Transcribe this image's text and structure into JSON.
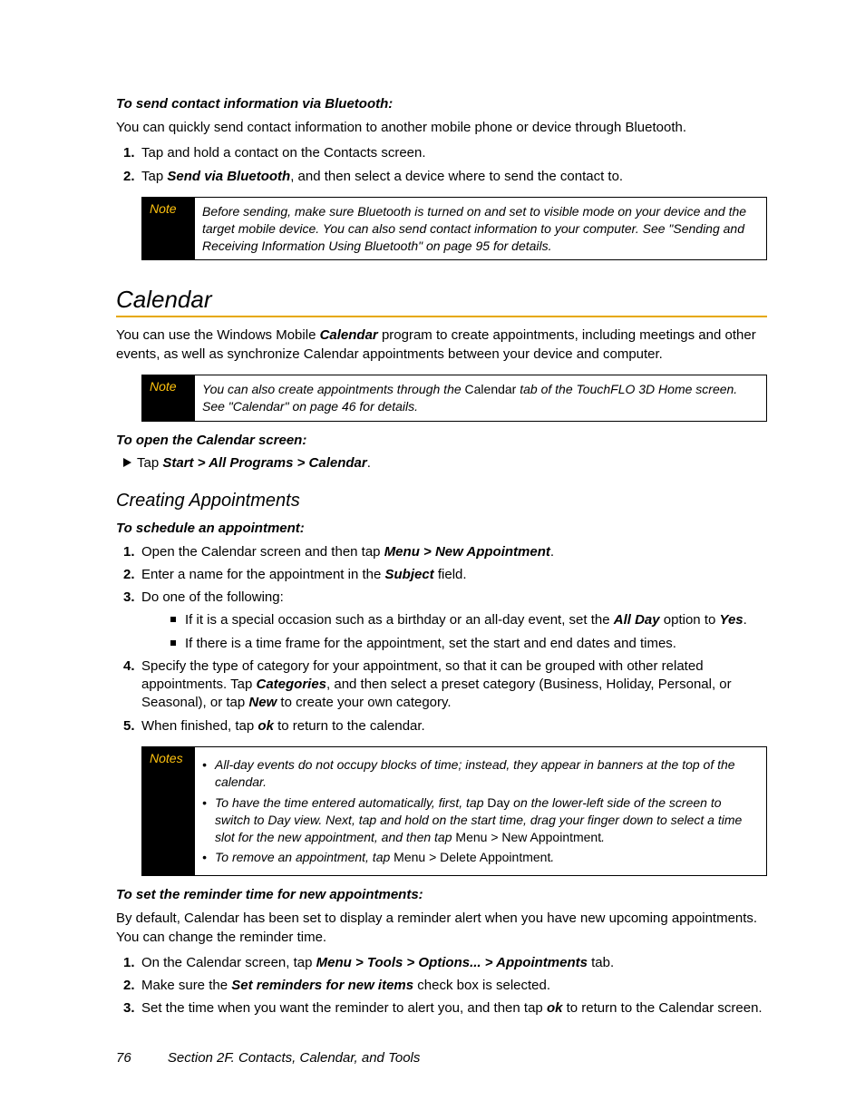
{
  "section_bt": {
    "task_heading": "To send  contact information via Bluetooth:",
    "intro": "You can quickly send contact information to another mobile phone or device through Bluetooth.",
    "steps": [
      {
        "text": "Tap and hold a contact on the Contacts screen."
      },
      {
        "lead": "Tap ",
        "bold": "Send via Bluetooth",
        "tail": ", and then select a device where to send the contact to."
      }
    ],
    "note_label": "Note",
    "note_body": "Before sending, make sure Bluetooth is turned on and set to visible mode on your device and the target mobile device. You can also send contact information to your computer. See \"Sending and Receiving Information Using Bluetooth\" on page 95 for details."
  },
  "calendar": {
    "title": "Calendar",
    "intro_lead": "You can use the Windows Mobile ",
    "intro_bold": "Calendar",
    "intro_tail": " program to create appointments, including meetings and other events, as well as synchronize Calendar appointments between your device and computer.",
    "note_label": "Note",
    "note_lead": "You can also create appointments through the ",
    "note_bold": "Calendar",
    "note_tail": " tab of the TouchFLO 3D Home screen. See \"Calendar\" on page 46 for details.",
    "open_heading": "To open the Calendar screen:",
    "open_tap": "Tap ",
    "open_path": "Start > All Programs > Calendar",
    "open_dot": "."
  },
  "creating": {
    "title": "Creating Appointments",
    "task_heading": "To schedule an appointment:",
    "step1_lead": "Open the Calendar screen and then tap ",
    "step1_bold": "Menu > New Appointment",
    "step1_tail": ".",
    "step2_lead": "Enter a name for the appointment in the ",
    "step2_bold": "Subject",
    "step2_tail": " field.",
    "step3": "Do one of the following:",
    "step3_b1_lead": "If it is a special occasion such as a birthday or an all-day event, set the ",
    "step3_b1_bold1": "All Day",
    "step3_b1_mid": " option to ",
    "step3_b1_bold2": "Yes",
    "step3_b1_tail": ".",
    "step3_b2": "If there is a time frame for the appointment, set the start and end dates and times.",
    "step4_lead": "Specify the type of category for your appointment, so that it can be grouped with other related appointments. Tap ",
    "step4_bold1": "Categories",
    "step4_mid": ", and then select a preset category (Business, Holiday, Personal, or Seasonal), or tap ",
    "step4_bold2": "New",
    "step4_tail": " to create your own category.",
    "step5_lead": "When finished, tap ",
    "step5_bold": "ok",
    "step5_tail": " to return to the calendar.",
    "notes_label": "Notes",
    "notes_b1": "All-day events do not occupy blocks of time; instead, they appear in banners at the top of the calendar.",
    "notes_b2_lead": "To have the time entered automatically, first, tap ",
    "notes_b2_bold1": "Day",
    "notes_b2_mid": " on the lower-left side of the screen to switch to Day view. Next, tap and hold on the start time,  drag  your finger down to select a time slot for the new appointment, and then tap ",
    "notes_b2_bold2": "Menu > New Appointment",
    "notes_b2_tail": ".",
    "notes_b3_lead": "To remove an appointment, tap ",
    "notes_b3_bold": "Menu > Delete Appointment",
    "notes_b3_tail": "."
  },
  "reminder": {
    "task_heading": "To set the reminder time for new appointments:",
    "intro": "By default, Calendar has been set to display a reminder alert when you have new upcoming appointments. You can change the reminder time.",
    "step1_lead": "On the Calendar screen, tap ",
    "step1_bold": "Menu > Tools > Options... > Appointments",
    "step1_tail": " tab.",
    "step2_lead": "Make sure the ",
    "step2_bold": "Set reminders for new items",
    "step2_tail": " check box is selected.",
    "step3_lead": "Set the time when you want the reminder to alert you, and then tap ",
    "step3_bold": "ok",
    "step3_tail": " to return to the Calendar screen."
  },
  "footer": {
    "page": "76",
    "section": "Section 2F. Contacts, Calendar, and Tools"
  }
}
